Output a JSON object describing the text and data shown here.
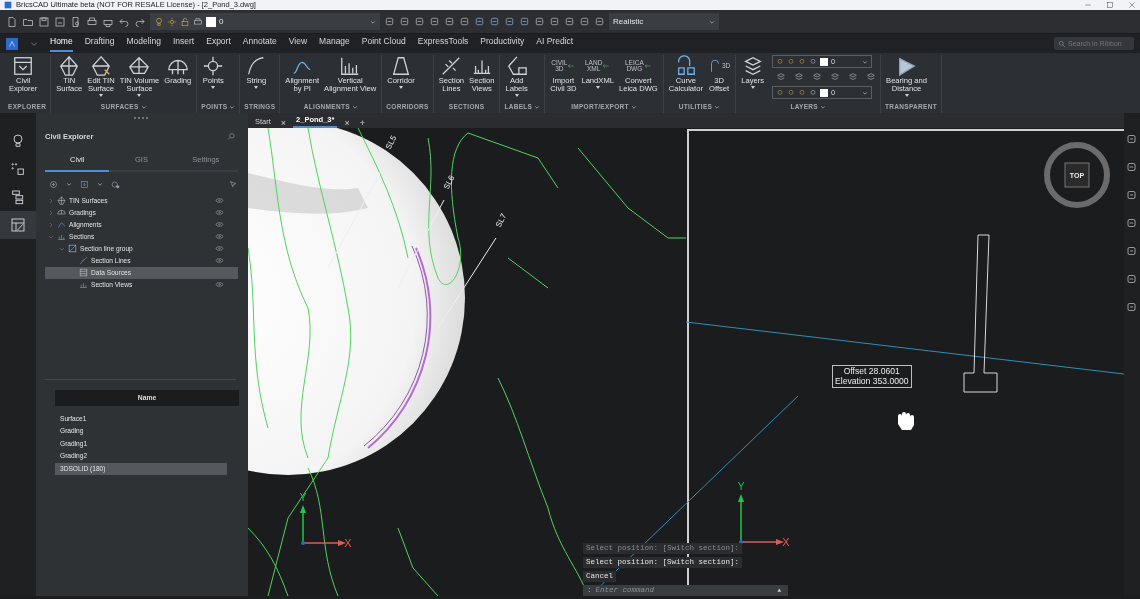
{
  "title_bar": {
    "title": "BricsCAD Ultimate beta (NOT FOR RESALE License) - [2_Pond_3.dwg]"
  },
  "quick_access": {
    "layer": "0",
    "visual_style": "Realistic"
  },
  "ribbon": {
    "tabs": [
      {
        "label": "Home",
        "selected": true
      },
      {
        "label": "Drafting",
        "selected": false
      },
      {
        "label": "Modeling",
        "selected": false
      },
      {
        "label": "Insert",
        "selected": false
      },
      {
        "label": "Export",
        "selected": false
      },
      {
        "label": "Annotate",
        "selected": false
      },
      {
        "label": "View",
        "selected": false
      },
      {
        "label": "Manage",
        "selected": false
      },
      {
        "label": "Point Cloud",
        "selected": false
      },
      {
        "label": "ExpressTools",
        "selected": false
      },
      {
        "label": "Productivity",
        "selected": false
      },
      {
        "label": "AI Predict",
        "selected": false
      }
    ],
    "search": {
      "placeholder": "Search in Ribbon"
    },
    "groups": [
      {
        "label": "EXPLORER",
        "dropdown": false,
        "buttons": [
          {
            "label": "Civil\nExplorer",
            "dropdown": false
          }
        ]
      },
      {
        "label": "SURFACES",
        "dropdown": true,
        "buttons": [
          {
            "label": "TIN\nSurface",
            "dropdown": false
          },
          {
            "label": "Edit TIN\nSurface",
            "dropdown": true
          },
          {
            "label": "TIN Volume\nSurface",
            "dropdown": true
          },
          {
            "label": "Grading",
            "dropdown": false
          }
        ]
      },
      {
        "label": "POINTS",
        "dropdown": true,
        "buttons": [
          {
            "label": "Points",
            "dropdown": true
          }
        ]
      },
      {
        "label": "STRINGS",
        "dropdown": false,
        "buttons": [
          {
            "label": "String",
            "dropdown": true
          }
        ]
      },
      {
        "label": "ALIGNMENTS",
        "dropdown": true,
        "buttons": [
          {
            "label": "Alignment\nby PI",
            "dropdown": false
          },
          {
            "label": "Vertical\nAlignment View",
            "dropdown": false
          }
        ]
      },
      {
        "label": "CORRIDORS",
        "dropdown": false,
        "buttons": [
          {
            "label": "Corridor",
            "dropdown": true
          }
        ]
      },
      {
        "label": "SECTIONS",
        "dropdown": false,
        "buttons": [
          {
            "label": "Section\nLines",
            "dropdown": false
          },
          {
            "label": "Section\nViews",
            "dropdown": false
          }
        ]
      },
      {
        "label": "LABELS",
        "dropdown": true,
        "buttons": [
          {
            "label": "Add\nLabels",
            "dropdown": true
          }
        ]
      },
      {
        "label": "IMPORT/EXPORT",
        "dropdown": true,
        "buttons": [
          {
            "label": "Import\nCivil 3D",
            "dropdown": false,
            "icon_text": "CIVIL\n3D"
          },
          {
            "label": "LandXML",
            "dropdown": true,
            "icon_text": "LAND\nXML"
          },
          {
            "label": "Convert\nLeica DWG",
            "dropdown": false,
            "icon_text": "LEICA\nDWG"
          }
        ]
      },
      {
        "label": "UTILITIES",
        "dropdown": true,
        "buttons": [
          {
            "label": "Curve\nCalculator",
            "dropdown": false
          },
          {
            "label": "3D\nOffset",
            "dropdown": false,
            "icon_text": "3D"
          }
        ]
      },
      {
        "label": "LAYERS",
        "dropdown": true,
        "buttons": [
          {
            "label": "Layers",
            "dropdown": true
          }
        ],
        "layer_combos": [
          {
            "value": "0"
          },
          {
            "value": "0"
          }
        ]
      },
      {
        "label": "TRANSPARENT",
        "dropdown": false,
        "buttons": [
          {
            "label": "Bearing and\nDistance",
            "dropdown": true
          }
        ]
      }
    ]
  },
  "side_tabs": [
    {
      "selected": false
    },
    {
      "selected": false
    },
    {
      "selected": false
    },
    {
      "selected": true
    }
  ],
  "explorer": {
    "title": "Civil Explorer",
    "tabs": [
      {
        "label": "Civil",
        "selected": true
      },
      {
        "label": "GIS",
        "selected": false
      },
      {
        "label": "Settings",
        "selected": false
      }
    ],
    "tree": [
      {
        "label": "TIN Surfaces",
        "kind": "folder",
        "expanded": false,
        "visible": true,
        "selected": false
      },
      {
        "label": "Gradings",
        "kind": "folder",
        "expanded": false,
        "visible": true,
        "selected": false
      },
      {
        "label": "Alignments",
        "kind": "folder",
        "expanded": false,
        "visible": true,
        "selected": false
      },
      {
        "label": "Sections",
        "kind": "folder",
        "expanded": true,
        "visible": true,
        "selected": false,
        "children": [
          {
            "label": "Section line group",
            "kind": "folder",
            "expanded": true,
            "visible": true,
            "selected": false,
            "children": [
              {
                "label": "Section Lines",
                "kind": "item",
                "visible": true,
                "selected": false
              },
              {
                "label": "Data Sources",
                "kind": "item",
                "visible": false,
                "selected": true
              },
              {
                "label": "Section Views",
                "kind": "item",
                "visible": true,
                "selected": false
              }
            ]
          }
        ]
      }
    ],
    "name_list": {
      "header": "Name",
      "rows": [
        {
          "name": "Surface1",
          "selected": false
        },
        {
          "name": "Grading",
          "selected": false
        },
        {
          "name": "Grading1",
          "selected": false
        },
        {
          "name": "Grading2",
          "selected": false
        },
        {
          "name": "3DSOLID (180)",
          "selected": true
        }
      ]
    }
  },
  "drawing_tabs": {
    "tabs": [
      {
        "label": "Start",
        "close": "×",
        "selected": false
      },
      {
        "label": "2_Pond_3*",
        "close": "×",
        "selected": true
      }
    ],
    "new_tab": "+"
  },
  "viewport": {
    "section_labels": [
      "SL5",
      "SL6",
      "SL7"
    ],
    "viewcube": "TOP",
    "tooltip": [
      "Offset 28.0601",
      "Elevation 353.0000"
    ],
    "axes": [
      {
        "x": "X",
        "y": "Y"
      },
      {
        "x": "X",
        "y": "Y"
      }
    ]
  },
  "command_line": {
    "history": [
      {
        "text": "Select position: [Switch section]:",
        "dimmed": true
      },
      {
        "text": "Select position: [Switch section]:",
        "dimmed": false
      },
      {
        "text": "Cancel",
        "dimmed": false
      }
    ],
    "prefix": ":",
    "placeholder": "Enter command",
    "expand": "▲"
  }
}
